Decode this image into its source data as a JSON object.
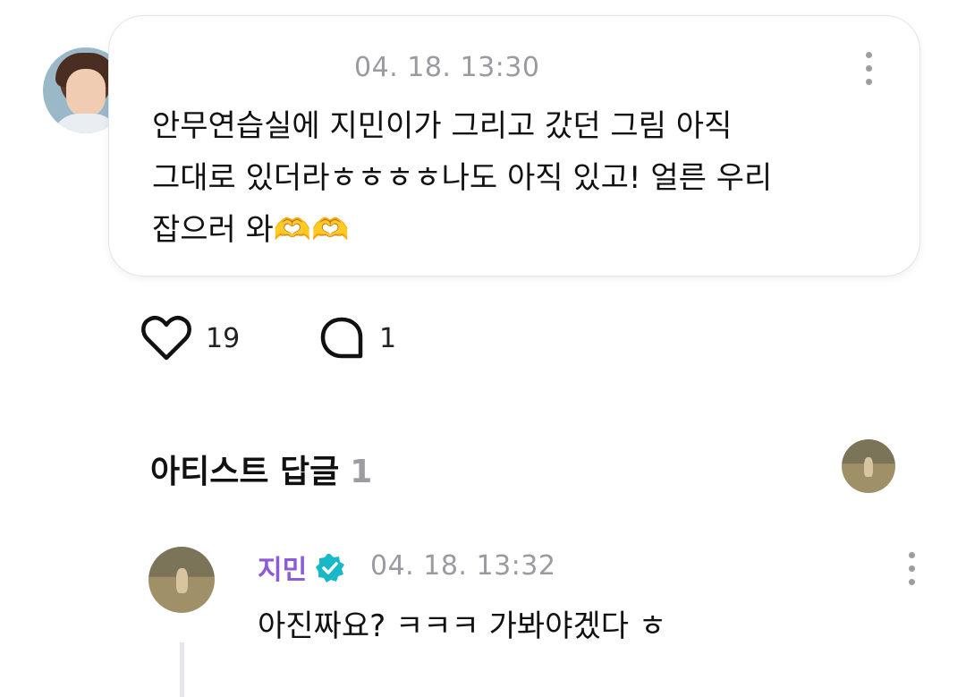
{
  "post": {
    "timestamp": "04. 18. 13:30",
    "body": "안무연습실에 지민이가 그리고 갔던 그림 아직\n그대로 있더라ㅎㅎㅎㅎ나도 아직 있고! 얼른 우리\n잡으러 와🫶🫶",
    "like_count": "19",
    "comment_count": "1"
  },
  "artist_replies": {
    "title": "아티스트 답글",
    "count": "1"
  },
  "reply": {
    "author": "지민",
    "timestamp": "04. 18. 13:32",
    "text": "아진짜요? ㅋㅋㅋ 가봐야겠다 ㅎ"
  },
  "icons": {
    "like": "heart-icon",
    "comment": "comment-bubble-icon",
    "more": "more-vertical-icon",
    "verified": "verified-badge-icon"
  },
  "colors": {
    "author_name": "#8b5cd6",
    "verified_badge": "#18b8c8",
    "meta_gray": "#9a9aa0"
  }
}
